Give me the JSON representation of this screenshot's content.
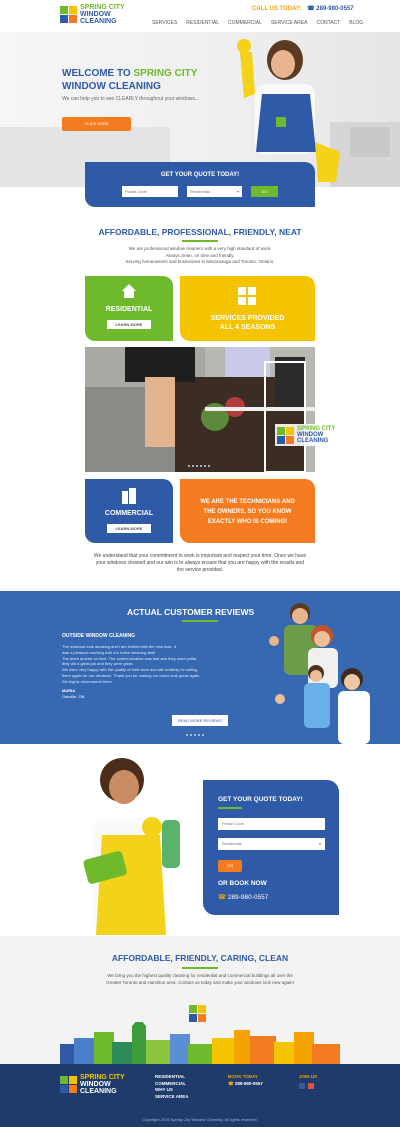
{
  "header": {
    "logo": {
      "line1": "SPRING CITY",
      "line2": "WINDOW",
      "line3": "CLEANING"
    },
    "call_label": "CALL US TODAY:",
    "phone": "289-980-0557",
    "nav": [
      "SERVICES",
      "RESIDENTIAL",
      "COMMERCIAL",
      "SERVICE AREA",
      "CONTACT",
      "BLOG"
    ],
    "colors": {
      "blue": "#2e5aa8",
      "green": "#6fba2c",
      "orange": "#f47b20",
      "yellow": "#f5c400"
    }
  },
  "hero": {
    "title_prefix": "WELCOME TO",
    "title_brand": "SPRING CITY",
    "title_line2": "WINDOW CLEANING",
    "subtitle": "We can help you to see CLEARLY throughout your windows...",
    "cta": "CLICK HERE"
  },
  "quote_bar": {
    "heading": "GET YOUR QUOTE TODAY!",
    "field1": "Postal Code",
    "field2": "Residential",
    "go": "GO"
  },
  "intro": {
    "heading": "AFFORDABLE, PROFESSIONAL, FRIENDLY, NEAT",
    "lines": [
      "We are professional window cleaners with a very high standard of work.",
      "Always clean, on time and friendly.",
      "Serving homeowners and businesses in Mississauga and Toronto, Ontario."
    ]
  },
  "tiles": {
    "residential": {
      "label": "RESIDENTIAL",
      "button": "LEARN MORE"
    },
    "seasons": {
      "line1": "SERVICES PROVIDED",
      "line2": "ALL 4 SEASONS"
    },
    "commercial": {
      "label": "COMMERCIAL",
      "button": "LEARN MORE"
    },
    "owners": {
      "line1": "WE ARE THE TECHNICIANS AND",
      "line2": "THE OWNERS, SO YOU KNOW",
      "line3": "EXACTLY WHO IS COMING!"
    }
  },
  "photo_logo": {
    "line1": "SPRING CITY",
    "line2": "WINDOW",
    "line3": "CLEANING"
  },
  "promise": {
    "lines": [
      "We understand that your commitment to work is important and respect your time. Once we have",
      "your windows cleaned and our aim is to always ensure that you are happy with the results and",
      "the service provided."
    ]
  },
  "reviews": {
    "heading": "ACTUAL CUSTOMER REVIEWS",
    "title": "OUTSIDE WINDOW CLEANING",
    "body": [
      "The windows look amazing and I am thrilled with the new look. It",
      "was a pleasure working with our entire cleaning staff.",
      "The team arrived on time. The communication was fast and they were polite,",
      "they did a great job and they were great.",
      "We were very happy with the quality of their work and will certainly be calling",
      "them again for our windows. Thank you for making our home look great again.",
      "We highly recommend them."
    ],
    "name": "MARIA",
    "location": "Oakville, ON",
    "read_more": "READ MORE REVIEWS"
  },
  "quote_box": {
    "heading": "GET YOUR QUOTE TODAY!",
    "field1": "Postal Code",
    "field2": "Residential",
    "go": "GO",
    "or_book": "OR BOOK NOW",
    "phone": "289-980-0557"
  },
  "band": {
    "heading": "AFFORDABLE, FRIENDLY, CARING, CLEAN",
    "lines": [
      "We bring you the highest quality cleaning for residential and commercial buildings all over the",
      "Greater Toronto and Hamilton area. Contact us today and make your windows look new again!"
    ]
  },
  "footer": {
    "logo": {
      "line1": "SPRING CITY",
      "line2": "WINDOW",
      "line3": "CLEANING"
    },
    "links": [
      "RESIDENTIAL",
      "COMMERCIAL",
      "WHY US",
      "SERVICE AREA"
    ],
    "book_label": "BOOK TODAY",
    "book_phone": "289-980-0557",
    "join": "JOIN US",
    "copyright": "Copyright 2019 Spring City Window Cleaning. All rights reserved."
  }
}
